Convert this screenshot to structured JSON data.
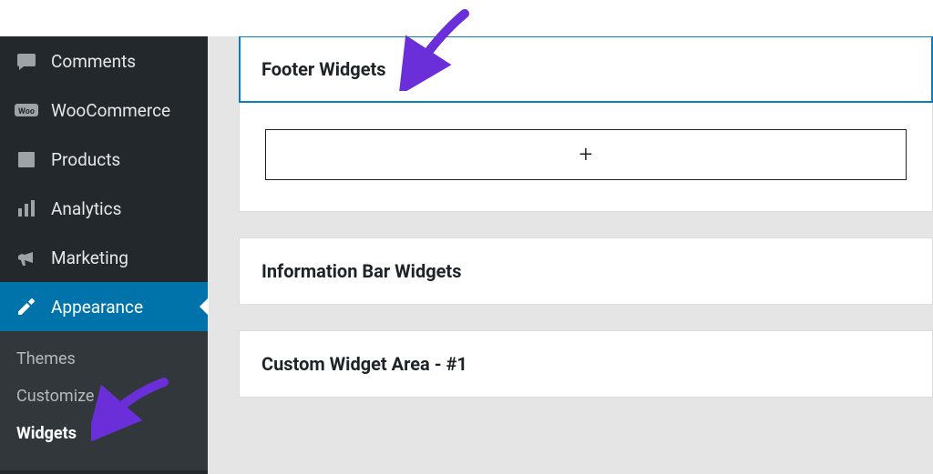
{
  "sidebar": {
    "items": [
      {
        "label": "Comments",
        "icon": "comments"
      },
      {
        "label": "WooCommerce",
        "icon": "woo"
      },
      {
        "label": "Products",
        "icon": "products"
      },
      {
        "label": "Analytics",
        "icon": "analytics"
      },
      {
        "label": "Marketing",
        "icon": "marketing"
      },
      {
        "label": "Appearance",
        "icon": "appearance"
      }
    ],
    "sub": [
      {
        "label": "Themes"
      },
      {
        "label": "Customize"
      },
      {
        "label": "Widgets"
      }
    ]
  },
  "areas": [
    {
      "title": "Footer Widgets",
      "selected": true,
      "hasAdd": true
    },
    {
      "title": "Information Bar Widgets"
    },
    {
      "title": "Custom Widget Area - #1"
    }
  ],
  "addGlyph": "+"
}
